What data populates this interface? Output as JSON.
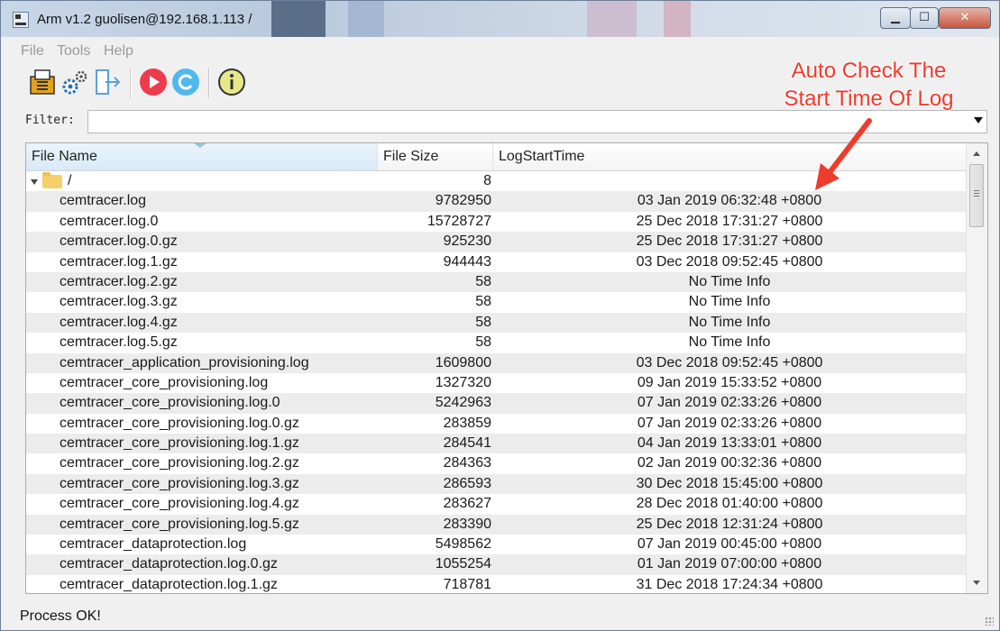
{
  "window": {
    "title": "Arm v1.2 guolisen@192.168.1.113 /",
    "controls": {
      "minimize": "▁",
      "maximize": "☐",
      "close": "✕"
    }
  },
  "menu": [
    "File",
    "Tools",
    "Help"
  ],
  "toolbar": {
    "buttons": [
      "database-export-icon",
      "settings-gears-icon",
      "logout-icon",
      "play-icon",
      "refresh-icon",
      "info-icon"
    ]
  },
  "filter": {
    "label": "Filter:",
    "value": ""
  },
  "table": {
    "columns": [
      "File Name",
      "File Size",
      "LogStartTime"
    ],
    "root": {
      "name": "/",
      "size": "8",
      "time": ""
    },
    "rows": [
      {
        "name": "cemtracer.log",
        "size": "9782950",
        "time": "03 Jan 2019 06:32:48 +0800"
      },
      {
        "name": "cemtracer.log.0",
        "size": "15728727",
        "time": "25 Dec 2018 17:31:27 +0800"
      },
      {
        "name": "cemtracer.log.0.gz",
        "size": "925230",
        "time": "25 Dec 2018 17:31:27 +0800"
      },
      {
        "name": "cemtracer.log.1.gz",
        "size": "944443",
        "time": "03 Dec 2018 09:52:45 +0800"
      },
      {
        "name": "cemtracer.log.2.gz",
        "size": "58",
        "time": "No Time Info"
      },
      {
        "name": "cemtracer.log.3.gz",
        "size": "58",
        "time": "No Time Info"
      },
      {
        "name": "cemtracer.log.4.gz",
        "size": "58",
        "time": "No Time Info"
      },
      {
        "name": "cemtracer.log.5.gz",
        "size": "58",
        "time": "No Time Info"
      },
      {
        "name": "cemtracer_application_provisioning.log",
        "size": "1609800",
        "time": "03 Dec 2018 09:52:45 +0800"
      },
      {
        "name": "cemtracer_core_provisioning.log",
        "size": "1327320",
        "time": "09 Jan 2019 15:33:52 +0800"
      },
      {
        "name": "cemtracer_core_provisioning.log.0",
        "size": "5242963",
        "time": "07 Jan 2019 02:33:26 +0800"
      },
      {
        "name": "cemtracer_core_provisioning.log.0.gz",
        "size": "283859",
        "time": "07 Jan 2019 02:33:26 +0800"
      },
      {
        "name": "cemtracer_core_provisioning.log.1.gz",
        "size": "284541",
        "time": "04 Jan 2019 13:33:01 +0800"
      },
      {
        "name": "cemtracer_core_provisioning.log.2.gz",
        "size": "284363",
        "time": "02 Jan 2019 00:32:36 +0800"
      },
      {
        "name": "cemtracer_core_provisioning.log.3.gz",
        "size": "286593",
        "time": "30 Dec 2018 15:45:00 +0800"
      },
      {
        "name": "cemtracer_core_provisioning.log.4.gz",
        "size": "283627",
        "time": "28 Dec 2018 01:40:00 +0800"
      },
      {
        "name": "cemtracer_core_provisioning.log.5.gz",
        "size": "283390",
        "time": "25 Dec 2018 12:31:24 +0800"
      },
      {
        "name": "cemtracer_dataprotection.log",
        "size": "5498562",
        "time": "07 Jan 2019 00:45:00 +0800"
      },
      {
        "name": "cemtracer_dataprotection.log.0.gz",
        "size": "1055254",
        "time": "01 Jan 2019 07:00:00 +0800"
      },
      {
        "name": "cemtracer_dataprotection.log.1.gz",
        "size": "718781",
        "time": "31 Dec 2018 17:24:34 +0800"
      }
    ]
  },
  "annotation": {
    "line1": "Auto Check The",
    "line2": "Start Time Of Log"
  },
  "status": {
    "text": "Process OK!"
  },
  "colors": {
    "annotation": "#ef3b2c",
    "alt_row": "#ececec",
    "header_active": "#d8eaf7"
  }
}
